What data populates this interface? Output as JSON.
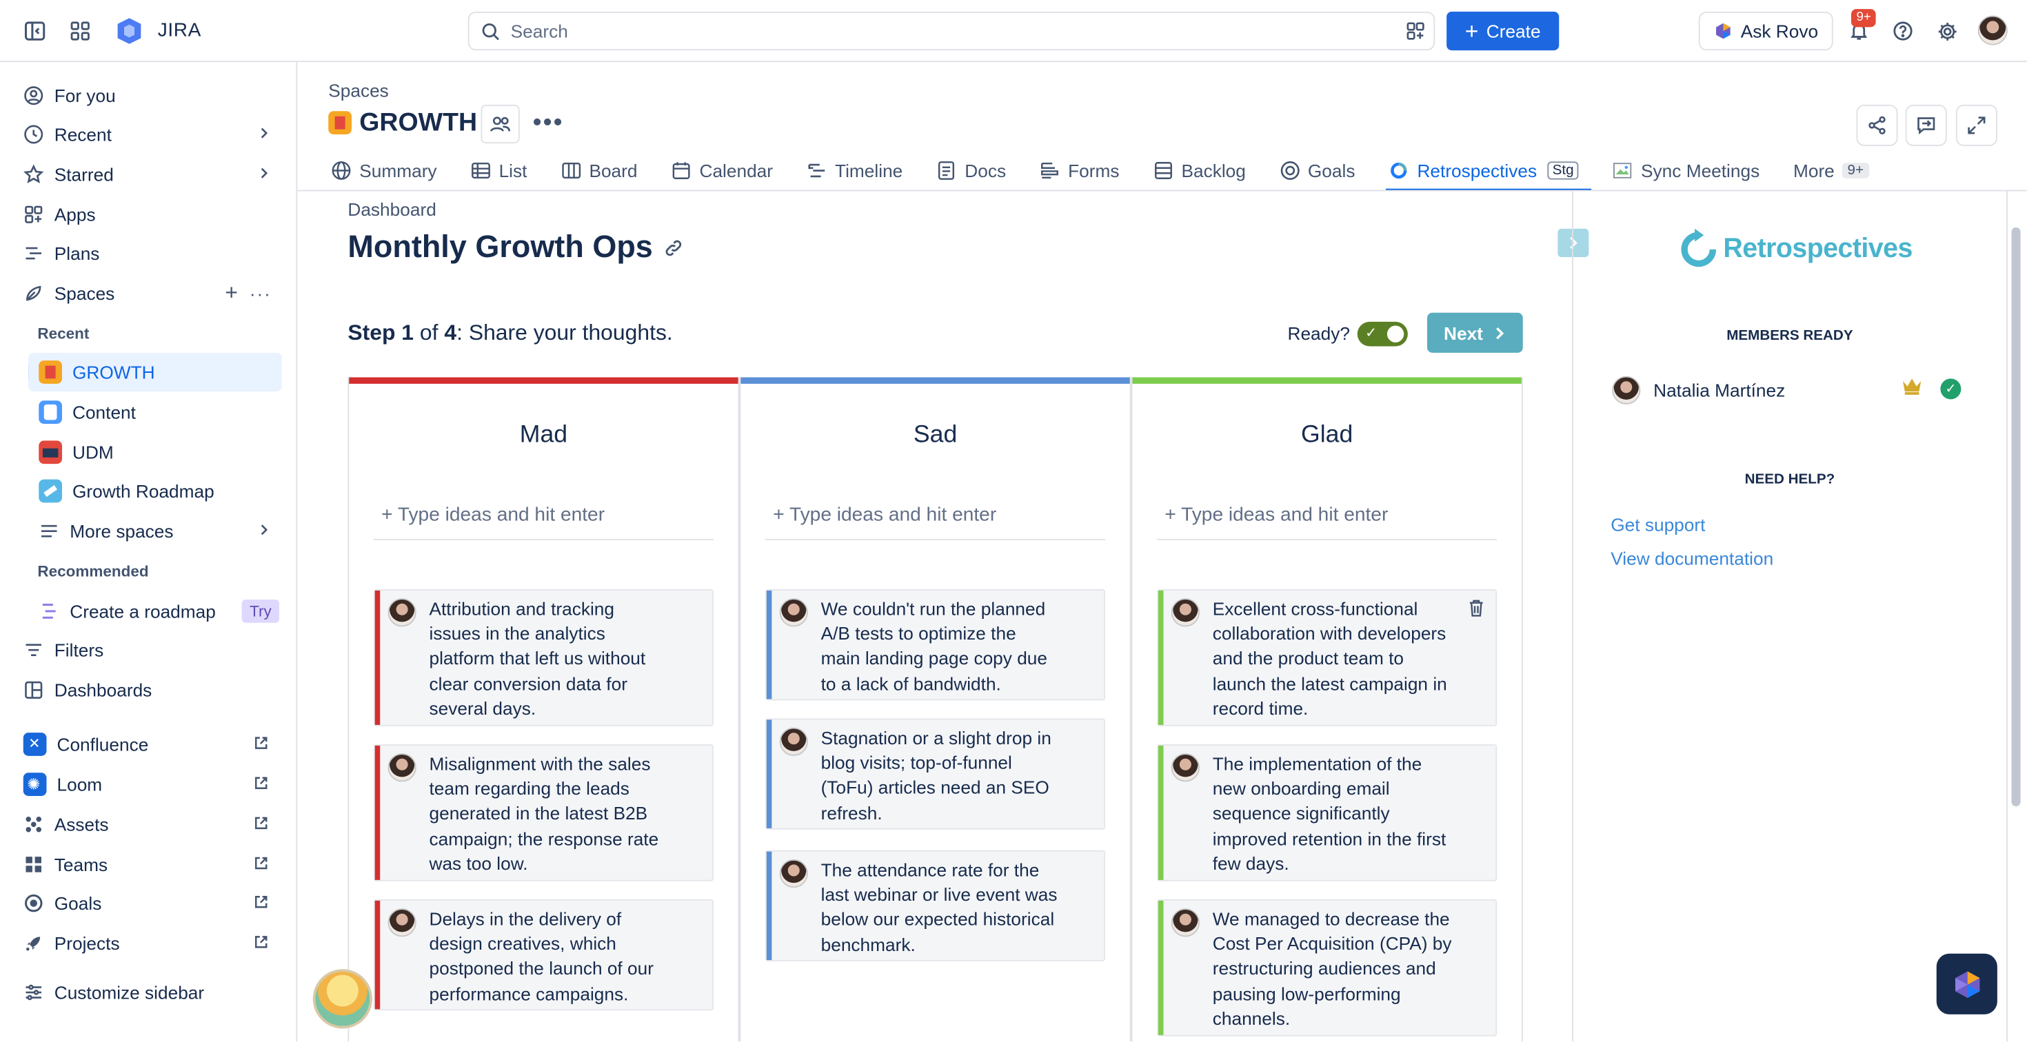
{
  "topbar": {
    "app_title": "JIRA",
    "search_placeholder": "Search",
    "create_label": "Create",
    "ask_rovo_label": "Ask Rovo",
    "notifications_badge": "9+"
  },
  "sidebar": {
    "items": [
      {
        "label": "For you",
        "icon": "user-circle-icon"
      },
      {
        "label": "Recent",
        "icon": "clock-icon"
      },
      {
        "label": "Starred",
        "icon": "star-icon"
      },
      {
        "label": "Apps",
        "icon": "apps-icon"
      },
      {
        "label": "Plans",
        "icon": "plans-icon"
      },
      {
        "label": "Spaces",
        "icon": "spaces-icon"
      }
    ],
    "recent_heading": "Recent",
    "recent_spaces": [
      {
        "label": "GROWTH",
        "color": "#f5a623"
      },
      {
        "label": "Content",
        "color": "#4c9aff"
      },
      {
        "label": "UDM",
        "color": "#e2483d"
      },
      {
        "label": "Growth Roadmap",
        "color": "#57b8e8"
      }
    ],
    "more_spaces": "More spaces",
    "recommended_heading": "Recommended",
    "create_roadmap": "Create a roadmap",
    "try_label": "Try",
    "filters": "Filters",
    "dashboards": "Dashboards",
    "apps_external": [
      {
        "label": "Confluence",
        "color": "#1868db"
      },
      {
        "label": "Loom",
        "color": "#1868db"
      },
      {
        "label": "Assets",
        "color": "#44546f"
      },
      {
        "label": "Teams",
        "color": "#44546f"
      },
      {
        "label": "Goals",
        "color": "#44546f"
      },
      {
        "label": "Projects",
        "color": "#44546f"
      }
    ],
    "customize": "Customize sidebar"
  },
  "header": {
    "breadcrumb": "Spaces",
    "project_title": "GROWTH"
  },
  "tabs": [
    {
      "label": "Summary"
    },
    {
      "label": "List"
    },
    {
      "label": "Board"
    },
    {
      "label": "Calendar"
    },
    {
      "label": "Timeline"
    },
    {
      "label": "Docs"
    },
    {
      "label": "Forms"
    },
    {
      "label": "Backlog"
    },
    {
      "label": "Goals"
    },
    {
      "label": "Retrospectives",
      "lozenge": "Stg",
      "active": true
    },
    {
      "label": "Sync Meetings"
    },
    {
      "label": "More",
      "count": "9+"
    }
  ],
  "board": {
    "dashboard_label": "Dashboard",
    "title": "Monthly Growth Ops",
    "step_prefix": "Step ",
    "step_num": "1",
    "step_of": " of ",
    "step_total": "4",
    "step_text": ": Share your thoughts.",
    "ready_label": "Ready?",
    "next_label": "Next",
    "input_placeholder": "+ Type ideas and hit enter",
    "columns": [
      {
        "title": "Mad",
        "color": "#d32f2f",
        "cards": [
          "Attribution and tracking issues in the analytics platform that left us without clear conversion data for several days.",
          "Misalignment with the sales team regarding the leads generated in the latest B2B campaign; the response rate was too low.",
          "Delays in the delivery of design creatives, which postponed the launch of our performance campaigns."
        ]
      },
      {
        "title": "Sad",
        "color": "#5b8fd6",
        "cards": [
          "We couldn't run the planned A/B tests to optimize the main landing page copy due to a lack of bandwidth.",
          "Stagnation or a slight drop in blog visits; top-of-funnel (ToFu) articles need an SEO refresh.",
          "The attendance rate for the last webinar or live event was below our expected historical benchmark."
        ]
      },
      {
        "title": "Glad",
        "color": "#7dcc4e",
        "cards": [
          "Excellent cross-functional collaboration with developers and the product team to launch the latest campaign in record time.",
          "The implementation of the new onboarding email sequence significantly improved retention in the first few days.",
          "We managed to decrease the Cost Per Acquisition (CPA) by restructuring audiences and pausing low-performing channels."
        ]
      }
    ]
  },
  "panel": {
    "logo_text": "Retrospectives",
    "members_heading": "MEMBERS READY",
    "member_name": "Natalia Martínez",
    "help_heading": "NEED HELP?",
    "get_support": "Get support",
    "view_docs": "View documentation"
  }
}
